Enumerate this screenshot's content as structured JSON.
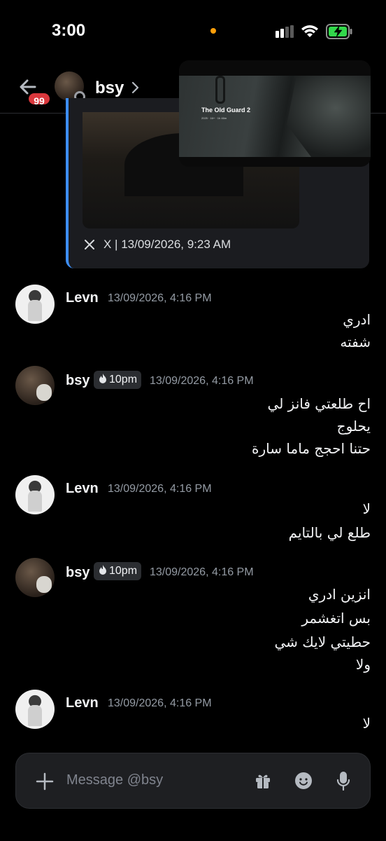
{
  "status": {
    "time": "3:00"
  },
  "header": {
    "badge": "99",
    "name": "bsy"
  },
  "pip": {
    "title": "The Old Guard 2",
    "meta": "2025 · 16+ · 1h 46m"
  },
  "embed": {
    "source": "X | 13/09/2026, 9:23 AM"
  },
  "messages": [
    {
      "author": "Levn",
      "timestamp": "13/09/2026, 4:16 PM",
      "lines": [
        "ادري",
        "شفته"
      ]
    },
    {
      "author": "bsy",
      "tag": "10pm",
      "timestamp": "13/09/2026, 4:16 PM",
      "lines": [
        "اح طلعتي فانز لي",
        "يحلوج",
        "حتنا احجج ماما سارة"
      ]
    },
    {
      "author": "Levn",
      "timestamp": "13/09/2026, 4:16 PM",
      "lines": [
        "لا",
        "طلع لي بالتايم"
      ]
    },
    {
      "author": "bsy",
      "tag": "10pm",
      "timestamp": "13/09/2026, 4:16 PM",
      "lines": [
        "انزين ادري",
        "بس اتغشمر",
        "حطيتي لايك شي",
        "ولا"
      ]
    },
    {
      "author": "Levn",
      "timestamp": "13/09/2026, 4:16 PM",
      "lines": [
        "لا"
      ]
    }
  ],
  "composer": {
    "placeholder": "Message @bsy"
  },
  "colors": {
    "accent": "#3d8ef5",
    "badge": "#da373c",
    "background": "#000000"
  }
}
